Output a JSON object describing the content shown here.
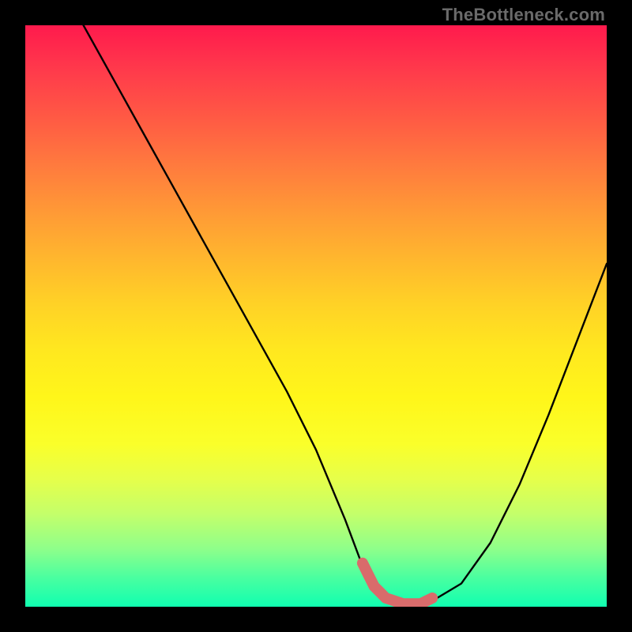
{
  "watermark": "TheBottleneck.com",
  "chart_data": {
    "type": "line",
    "title": "",
    "xlabel": "",
    "ylabel": "",
    "xlim": [
      0,
      100
    ],
    "ylim": [
      0,
      100
    ],
    "series": [
      {
        "name": "bottleneck-curve",
        "x": [
          10,
          15,
          20,
          25,
          30,
          35,
          40,
          45,
          50,
          55,
          58,
          60,
          62,
          65,
          68,
          70,
          75,
          80,
          85,
          90,
          95,
          100
        ],
        "y": [
          100,
          91,
          82,
          73,
          64,
          55,
          46,
          37,
          27,
          15,
          7,
          3,
          1,
          0,
          0,
          1,
          4,
          11,
          21,
          33,
          46,
          59
        ]
      },
      {
        "name": "highlight-range",
        "x": [
          58,
          70
        ],
        "y": [
          2,
          2
        ]
      }
    ],
    "gradient_stops": [
      {
        "pos": 0,
        "color": "#ff1a4d"
      },
      {
        "pos": 50,
        "color": "#ffe81f"
      },
      {
        "pos": 100,
        "color": "#10ffb0"
      }
    ]
  }
}
